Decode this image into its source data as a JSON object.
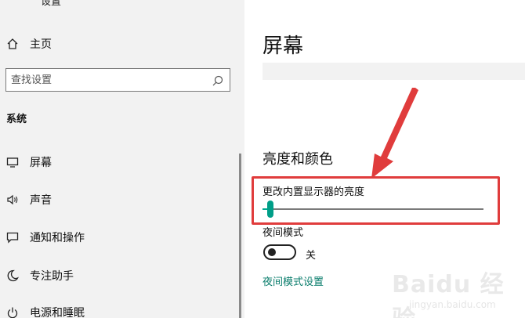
{
  "window": {
    "title": "设置"
  },
  "sidebar": {
    "home_label": "主页",
    "search_placeholder": "查找设置",
    "section_heading": "系统",
    "items": [
      {
        "label": "屏幕",
        "icon": "monitor-icon"
      },
      {
        "label": "声音",
        "icon": "speaker-icon"
      },
      {
        "label": "通知和操作",
        "icon": "notification-icon"
      },
      {
        "label": "专注助手",
        "icon": "moon-icon"
      },
      {
        "label": "电源和睡眠",
        "icon": "power-icon"
      }
    ]
  },
  "main": {
    "title": "屏幕",
    "section_title": "亮度和颜色",
    "brightness_label": "更改内置显示器的亮度",
    "brightness_value": 0.02,
    "night_light_label": "夜间模式",
    "night_light_state": "关",
    "night_light_on": false,
    "night_light_settings_link": "夜间模式设置"
  },
  "watermark": {
    "text": "Baidu 经验",
    "sub": "jingyan.baidu.com"
  },
  "colors": {
    "accent": "#009e88",
    "annotation": "#e03c3c",
    "link": "#0a7d6c"
  }
}
